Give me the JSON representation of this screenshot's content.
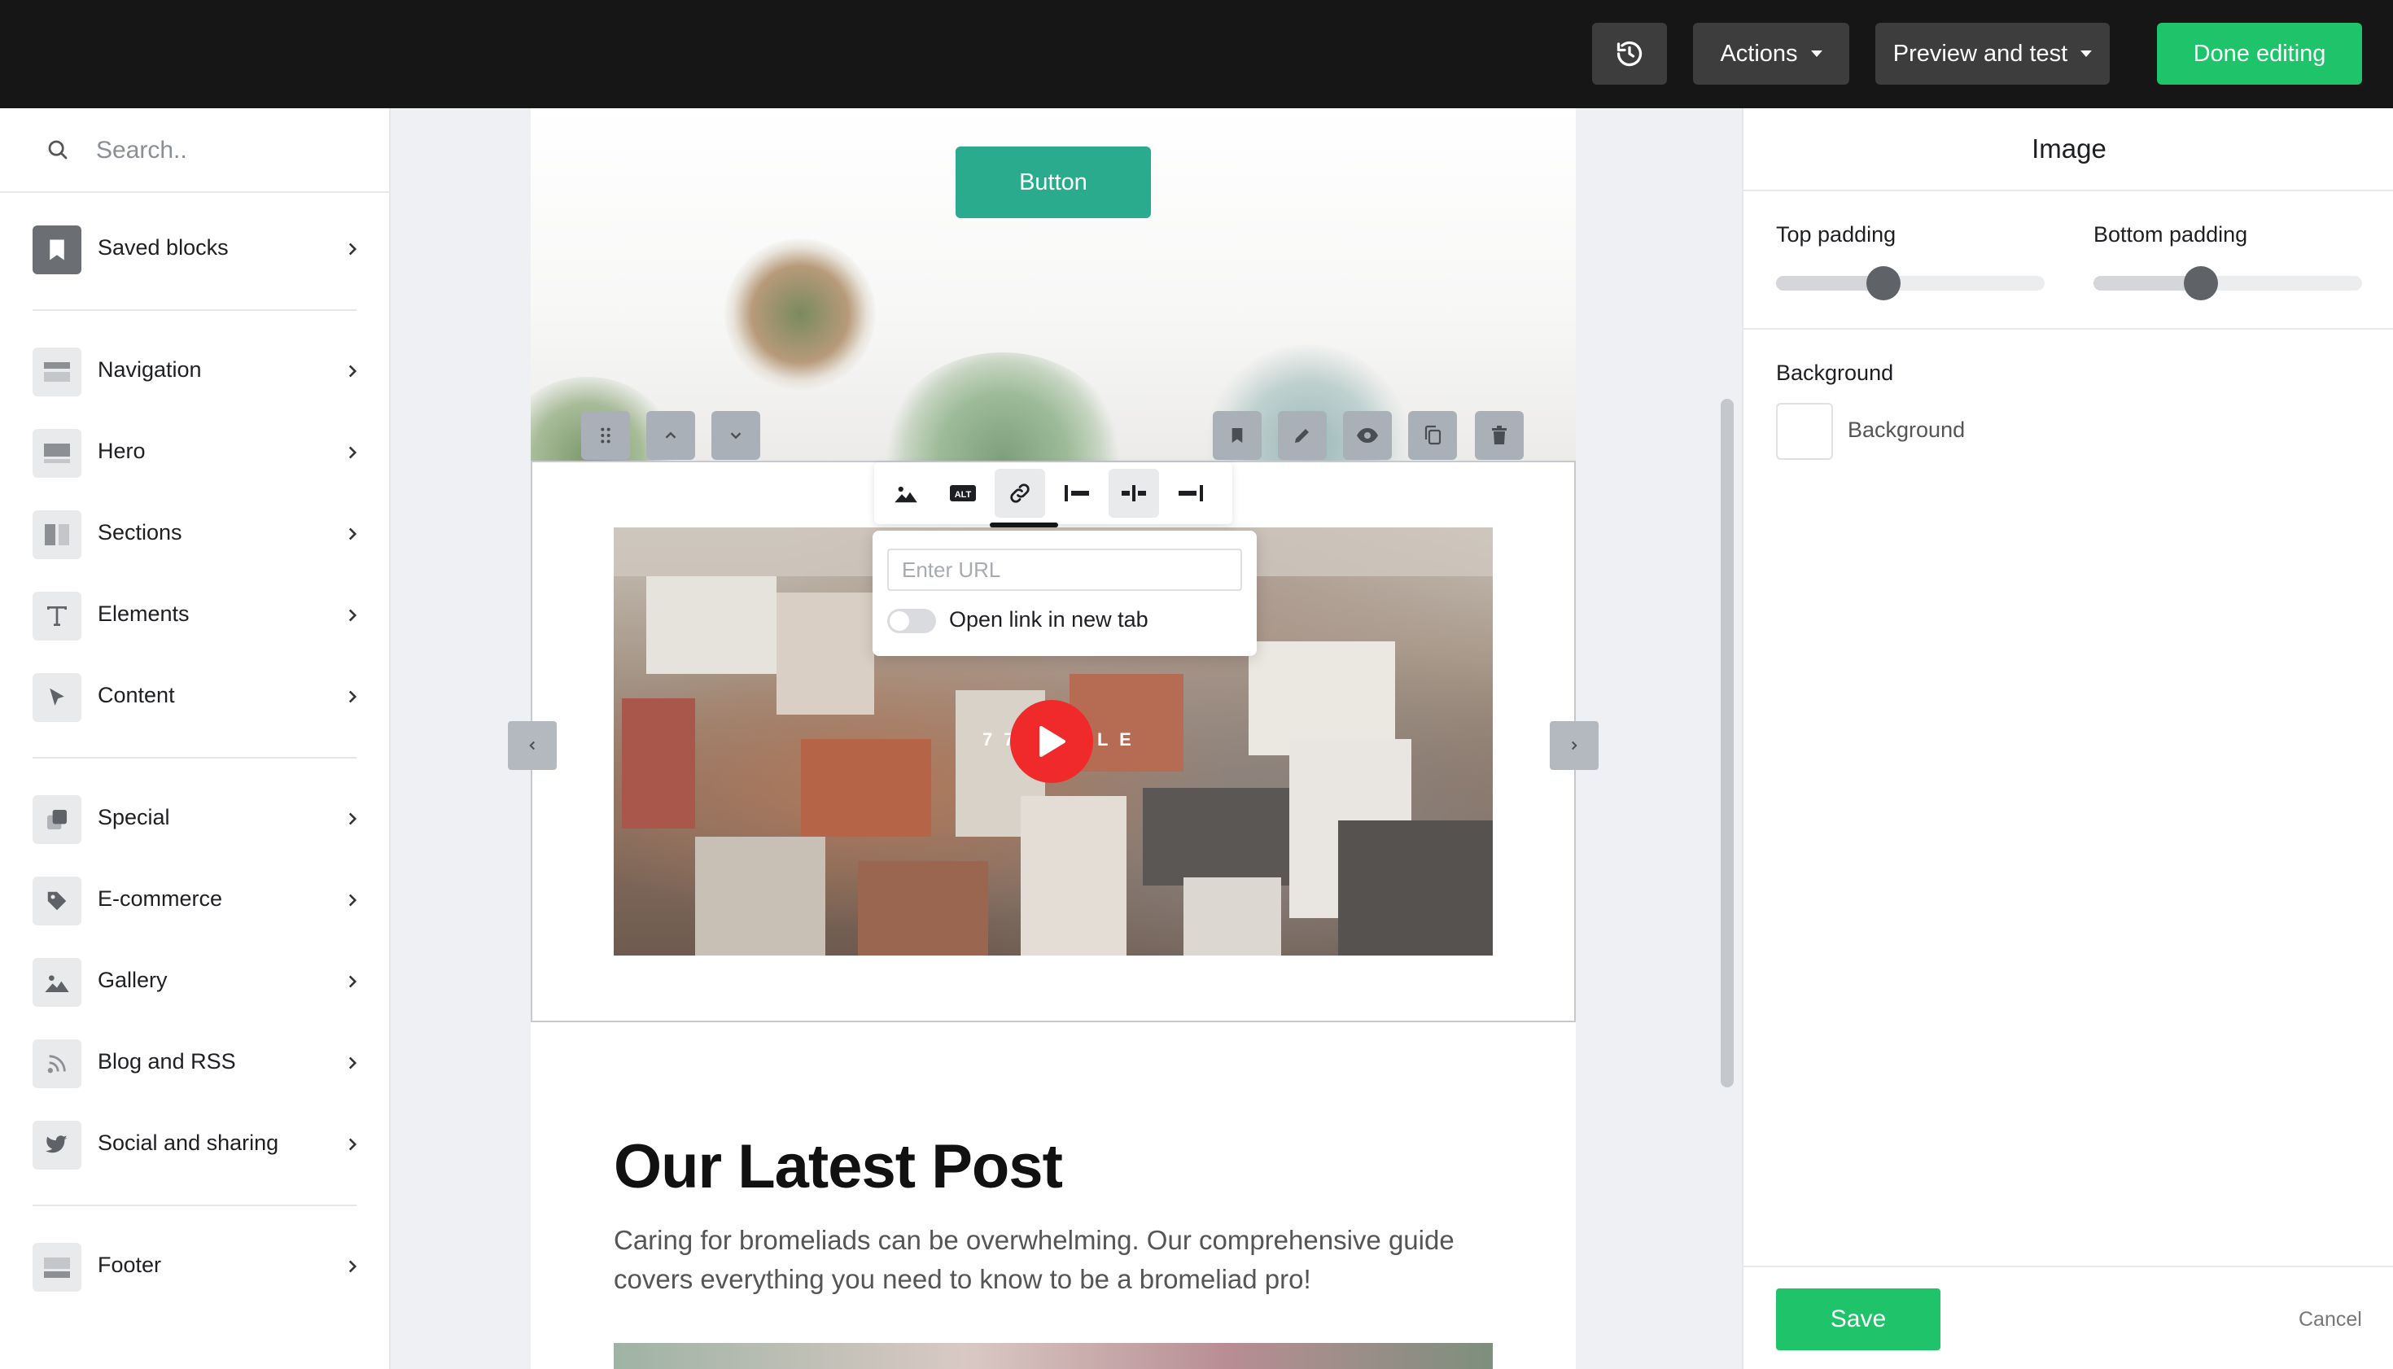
{
  "topbar": {
    "history_icon": "history-icon",
    "actions_label": "Actions",
    "preview_label": "Preview and test",
    "done_label": "Done editing",
    "done_color": "#1ec36a"
  },
  "sidebar": {
    "search_placeholder": "Search..",
    "saved_blocks": "Saved blocks",
    "items": [
      {
        "label": "Navigation",
        "icon": "navigation-icon"
      },
      {
        "label": "Hero",
        "icon": "hero-icon"
      },
      {
        "label": "Sections",
        "icon": "sections-icon"
      },
      {
        "label": "Elements",
        "icon": "text-icon"
      },
      {
        "label": "Content",
        "icon": "cursor-icon"
      },
      {
        "label": "Special",
        "icon": "special-icon"
      },
      {
        "label": "E-commerce",
        "icon": "tag-icon"
      },
      {
        "label": "Gallery",
        "icon": "image-icon"
      },
      {
        "label": "Blog and RSS",
        "icon": "rss-icon"
      },
      {
        "label": "Social and sharing",
        "icon": "twitter-icon"
      },
      {
        "label": "Footer",
        "icon": "footer-icon"
      }
    ]
  },
  "canvas": {
    "hero_button": "Button",
    "image_toolbar": {
      "alt_label": "ALT"
    },
    "link_popover": {
      "url_placeholder": "Enter URL",
      "new_tab_label": "Open link in new tab"
    },
    "video_overlay_left": "7 7",
    "video_overlay_right": "L E",
    "post_title": "Our Latest Post",
    "post_body": "Caring for bromeliads can be overwhelming. Our comprehensive guide covers everything you need to know to be a bromeliad pro!",
    "play_color": "#f02a2a"
  },
  "panel": {
    "title": "Image",
    "top_padding_label": "Top padding",
    "bottom_padding_label": "Bottom padding",
    "top_padding_value": 0.4,
    "bottom_padding_value": 0.4,
    "background_heading": "Background",
    "background_label": "Background",
    "save_label": "Save",
    "cancel_label": "Cancel"
  }
}
